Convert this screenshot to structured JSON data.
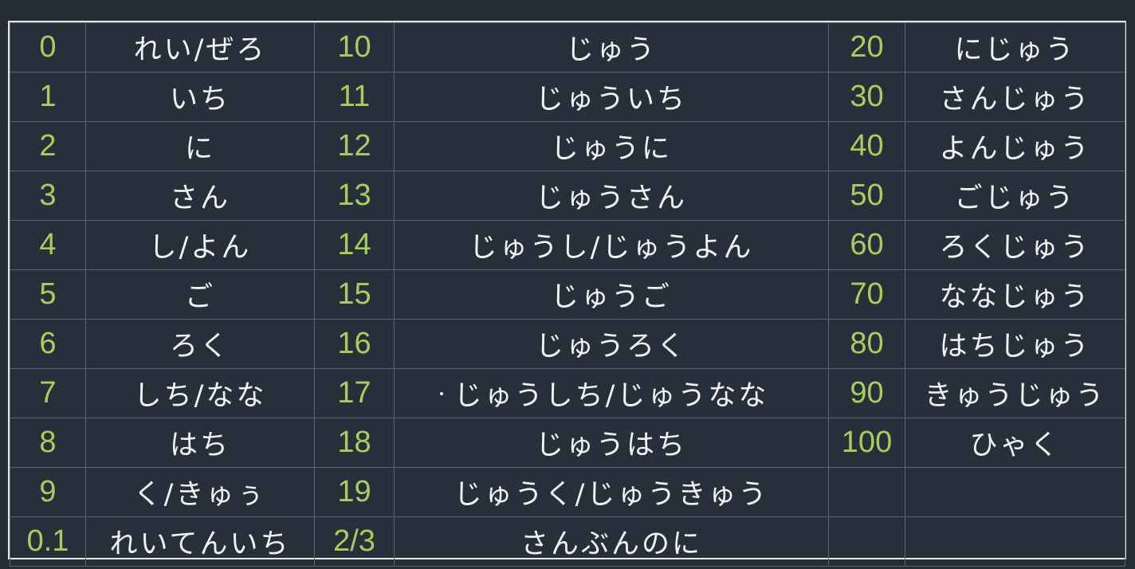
{
  "table": {
    "rows": [
      {
        "n1": "0",
        "k1": "れい/ぜろ",
        "n2": "10",
        "k2": "じゅう",
        "n3": "20",
        "k3": "にじゅう"
      },
      {
        "n1": "1",
        "k1": "いち",
        "n2": "11",
        "k2": "じゅういち",
        "n3": "30",
        "k3": "さんじゅう"
      },
      {
        "n1": "2",
        "k1": "に",
        "n2": "12",
        "k2": "じゅうに",
        "n3": "40",
        "k3": "よんじゅう"
      },
      {
        "n1": "3",
        "k1": "さん",
        "n2": "13",
        "k2": "じゅうさん",
        "n3": "50",
        "k3": "ごじゅう"
      },
      {
        "n1": "4",
        "k1": "し/よん",
        "n2": "14",
        "k2": "じゅうし/じゅうよん",
        "n3": "60",
        "k3": "ろくじゅう"
      },
      {
        "n1": "5",
        "k1": "ご",
        "n2": "15",
        "k2": "じゅうご",
        "n3": "70",
        "k3": "ななじゅう"
      },
      {
        "n1": "6",
        "k1": "ろく",
        "n2": "16",
        "k2": "じゅうろく",
        "n3": "80",
        "k3": "はちじゅう"
      },
      {
        "n1": "7",
        "k1": "しち/なな",
        "n2": "17",
        "k2": "じゅうしち/じゅうなな",
        "n3": "90",
        "k3": "きゅうじゅう"
      },
      {
        "n1": "8",
        "k1": "はち",
        "n2": "18",
        "k2": "じゅうはち",
        "n3": "100",
        "k3": "ひゃく"
      },
      {
        "n1": "9",
        "k1": "く/きゅぅ",
        "n2": "19",
        "k2": "じゅうく/じゅうきゅう",
        "n3": "",
        "k3": ""
      },
      {
        "n1": "0.1",
        "k1": "れいてんいち",
        "n2": "2/3",
        "k2": "さんぶんのに",
        "n3": "",
        "k3": ""
      }
    ]
  },
  "colors": {
    "background": "#262d35",
    "number_text": "#a9cd5d",
    "kana_text": "#f1f3f5",
    "grid_line": "#5b646e",
    "frame_border": "#e6e9ec"
  }
}
